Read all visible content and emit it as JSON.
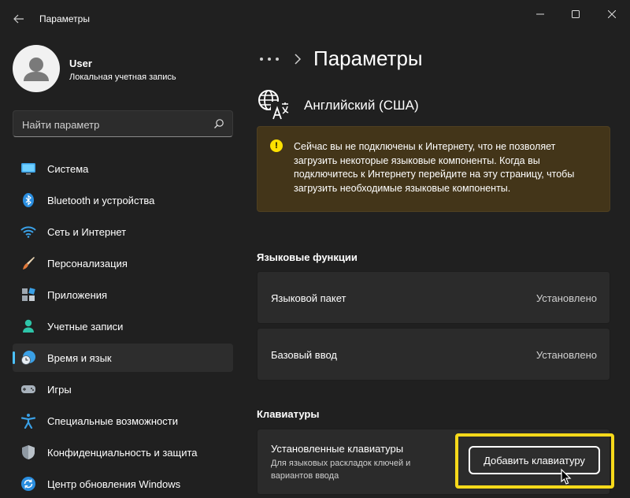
{
  "window": {
    "title": "Параметры",
    "icons": {
      "back": "back-arrow-icon",
      "minimize": "minimize-icon",
      "maximize": "maximize-icon",
      "close": "close-icon"
    }
  },
  "profile": {
    "name": "User",
    "account_type": "Локальная учетная запись"
  },
  "search": {
    "placeholder": "Найти параметр",
    "icon": "search-icon"
  },
  "sidebar": {
    "items": [
      {
        "label": "Система",
        "icon": "system-icon",
        "active": false
      },
      {
        "label": "Bluetooth и устройства",
        "icon": "bluetooth-icon",
        "active": false
      },
      {
        "label": "Сеть и Интернет",
        "icon": "wifi-icon",
        "active": false
      },
      {
        "label": "Персонализация",
        "icon": "brush-icon",
        "active": false
      },
      {
        "label": "Приложения",
        "icon": "apps-icon",
        "active": false
      },
      {
        "label": "Учетные записи",
        "icon": "accounts-icon",
        "active": false
      },
      {
        "label": "Время и язык",
        "icon": "time-language-icon",
        "active": true
      },
      {
        "label": "Игры",
        "icon": "gamepad-icon",
        "active": false
      },
      {
        "label": "Специальные возможности",
        "icon": "accessibility-icon",
        "active": false
      },
      {
        "label": "Конфиденциальность и защита",
        "icon": "shield-icon",
        "active": false
      },
      {
        "label": "Центр обновления Windows",
        "icon": "update-icon",
        "active": false
      }
    ]
  },
  "main": {
    "breadcrumb_more": "•••",
    "page_title": "Параметры",
    "language_title": "Английский (США)",
    "warning": "Сейчас вы не подключены к Интернету, что не позволяет загрузить некоторые языковые компоненты. Когда вы подключитесь к Интернету перейдите на эту страницу, чтобы загрузить необходимые языковые компоненты.",
    "language_features": {
      "title": "Языковые функции",
      "rows": [
        {
          "label": "Языковой пакет",
          "value": "Установлено"
        },
        {
          "label": "Базовый ввод",
          "value": "Установлено"
        }
      ]
    },
    "keyboards": {
      "title": "Клавиатуры",
      "installed_label": "Установленные клавиатуры",
      "installed_desc": "Для языковых раскладок ключей и вариантов ввода",
      "add_button": "Добавить клавиатуру"
    }
  },
  "colors": {
    "accent": "#4cc2ff",
    "highlight": "#f7d91a",
    "warning_bg": "#433519",
    "warning_icon": "#fce100"
  }
}
